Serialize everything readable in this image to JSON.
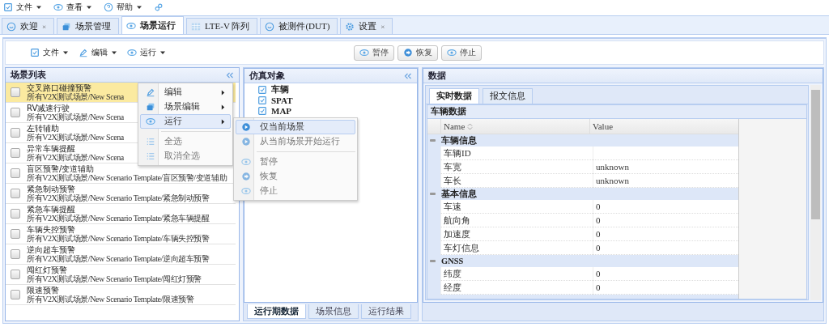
{
  "menubar": [
    {
      "label": "文件"
    },
    {
      "label": "查看"
    },
    {
      "label": "帮助"
    }
  ],
  "tabs": [
    {
      "label": "欢迎",
      "selected": false,
      "close_mark": "×"
    },
    {
      "label": "场景管理",
      "selected": false
    },
    {
      "label": "场景运行",
      "selected": true
    },
    {
      "label": "LTE-V 阵列",
      "selected": false
    },
    {
      "label": "被测件(DUT)",
      "selected": false
    },
    {
      "label": "设置",
      "selected": false,
      "close_mark": "×"
    }
  ],
  "toolbar": {
    "menus": [
      "文件",
      "编辑",
      "运行"
    ],
    "buttons": [
      "暂停",
      "恢复",
      "停止"
    ]
  },
  "scenario_list": {
    "title": "场景列表",
    "items": [
      {
        "name": "交叉路口碰撞预警",
        "path": "所有V2X测试场景/New Scena",
        "checked": false,
        "selected": true
      },
      {
        "name": "RV减速行驶",
        "path": "所有V2X测试场景/New Scena",
        "checked": false,
        "selected": false
      },
      {
        "name": "左转辅助",
        "path": "所有V2X测试场景/New Scena",
        "checked": false,
        "selected": false
      },
      {
        "name": "异常车辆提醒",
        "path": "所有V2X测试场景/New Scena",
        "checked": false,
        "selected": false
      },
      {
        "name": "盲区预警/变道辅助",
        "path": "所有V2X测试场景/New Scenario Template/盲区预警/变道辅助",
        "checked": false,
        "selected": false
      },
      {
        "name": "紧急制动预警",
        "path": "所有V2X测试场景/New Scenario Template/紧急制动预警",
        "checked": false,
        "selected": false
      },
      {
        "name": "紧急车辆提醒",
        "path": "所有V2X测试场景/New Scenario Template/紧急车辆提醒",
        "checked": false,
        "selected": false
      },
      {
        "name": "车辆失控预警",
        "path": "所有V2X测试场景/New Scenario Template/车辆失控预警",
        "checked": false,
        "selected": false
      },
      {
        "name": "逆向超车预警",
        "path": "所有V2X测试场景/New Scenario Template/逆向超车预警",
        "checked": false,
        "selected": false
      },
      {
        "name": "闯红灯预警",
        "path": "所有V2X测试场景/New Scenario Template/闯红灯预警",
        "checked": false,
        "selected": false
      },
      {
        "name": "限速预警",
        "path": "所有V2X测试场景/New Scenario Template/限速预警",
        "checked": false,
        "selected": false
      }
    ]
  },
  "context_menu": {
    "items": [
      {
        "kind": "item",
        "label": "编辑",
        "submenu": true,
        "selected": false,
        "disabled": false
      },
      {
        "kind": "item",
        "label": "场景编辑",
        "submenu": true,
        "selected": false,
        "disabled": false
      },
      {
        "kind": "item",
        "label": "运行",
        "submenu": true,
        "selected": true,
        "disabled": false
      },
      {
        "kind": "separator"
      },
      {
        "kind": "item",
        "label": "全选",
        "submenu": false,
        "selected": false,
        "disabled": true
      },
      {
        "kind": "item",
        "label": "取消全选",
        "submenu": false,
        "selected": false,
        "disabled": true
      }
    ],
    "submenu": [
      {
        "kind": "item",
        "label": "仅当前场景",
        "selected": true,
        "disabled": false
      },
      {
        "kind": "item",
        "label": "从当前场景开始运行",
        "selected": false,
        "disabled": true
      },
      {
        "kind": "separator"
      },
      {
        "kind": "item",
        "label": "暂停",
        "selected": false,
        "disabled": true
      },
      {
        "kind": "item",
        "label": "恢复",
        "selected": false,
        "disabled": true
      },
      {
        "kind": "item",
        "label": "停止",
        "selected": false,
        "disabled": true
      }
    ]
  },
  "sim_objects": {
    "title": "仿真对象",
    "items": [
      "车辆",
      "SPAT",
      "MAP"
    ],
    "tabs": [
      {
        "label": "运行期数据",
        "selected": true
      },
      {
        "label": "场景信息",
        "selected": false
      },
      {
        "label": "运行结果",
        "selected": false
      }
    ]
  },
  "data_panel": {
    "title": "数据",
    "tabs": [
      {
        "label": "实时数据",
        "selected": true
      },
      {
        "label": "报文信息",
        "selected": false
      }
    ],
    "section": "车辆数据",
    "columns": [
      "Name",
      "Value"
    ],
    "groups": [
      {
        "name": "车辆信息",
        "expanded": true,
        "rows": [
          {
            "name": "车辆ID",
            "value": ""
          },
          {
            "name": "车宽",
            "value": "unknown"
          },
          {
            "name": "车长",
            "value": "unknown"
          }
        ]
      },
      {
        "name": "基本信息",
        "expanded": true,
        "rows": [
          {
            "name": "车速",
            "value": "0"
          },
          {
            "name": "航向角",
            "value": "0"
          },
          {
            "name": "加速度",
            "value": "0"
          },
          {
            "name": "车灯信息",
            "value": "0"
          }
        ]
      },
      {
        "name": "GNSS",
        "expanded": true,
        "rows": [
          {
            "name": "纬度",
            "value": "0"
          },
          {
            "name": "经度",
            "value": "0"
          }
        ]
      }
    ]
  }
}
